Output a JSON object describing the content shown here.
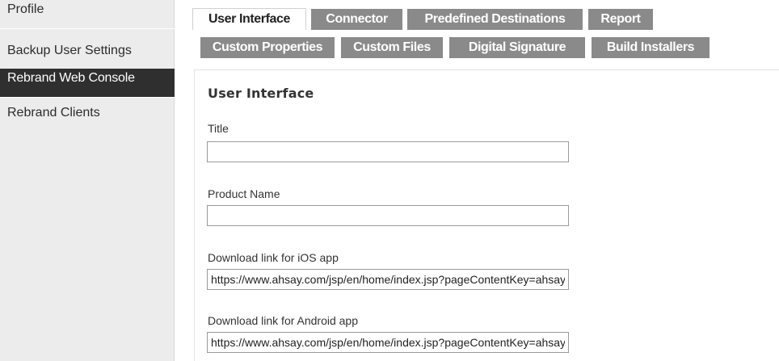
{
  "sidebar": {
    "items": [
      {
        "label": "Profile",
        "active": false
      },
      {
        "label": "Backup User Settings",
        "active": false
      },
      {
        "label": "Rebrand Web Console",
        "active": true
      },
      {
        "label": "Rebrand Clients",
        "active": false
      }
    ]
  },
  "tabs": {
    "row1": [
      {
        "label": "User Interface",
        "active": true
      },
      {
        "label": "Connector",
        "active": false
      },
      {
        "label": "Predefined Destinations",
        "active": false
      },
      {
        "label": "Report",
        "active": false
      }
    ],
    "row2": [
      {
        "label": "Custom Properties",
        "active": false
      },
      {
        "label": "Custom Files",
        "active": false
      },
      {
        "label": "Digital Signature",
        "active": false
      },
      {
        "label": "Build Installers",
        "active": false
      }
    ]
  },
  "panel": {
    "title": "User Interface",
    "fields": [
      {
        "label": "Title",
        "value": ""
      },
      {
        "label": "Product Name",
        "value": ""
      },
      {
        "label": "Download link for iOS app",
        "value": "https://www.ahsay.com/jsp/en/home/index.jsp?pageContentKey=ahsay_mobile_ios"
      },
      {
        "label": "Download link for Android app",
        "value": "https://www.ahsay.com/jsp/en/home/index.jsp?pageContentKey=ahsay_mobile_android"
      }
    ]
  },
  "colors": {
    "sidebar_bg": "#ececec",
    "sidebar_active_bg": "#2f2f2f",
    "tab_inactive_bg": "#8a8a8a",
    "tab_active_bg": "#ffffff"
  }
}
